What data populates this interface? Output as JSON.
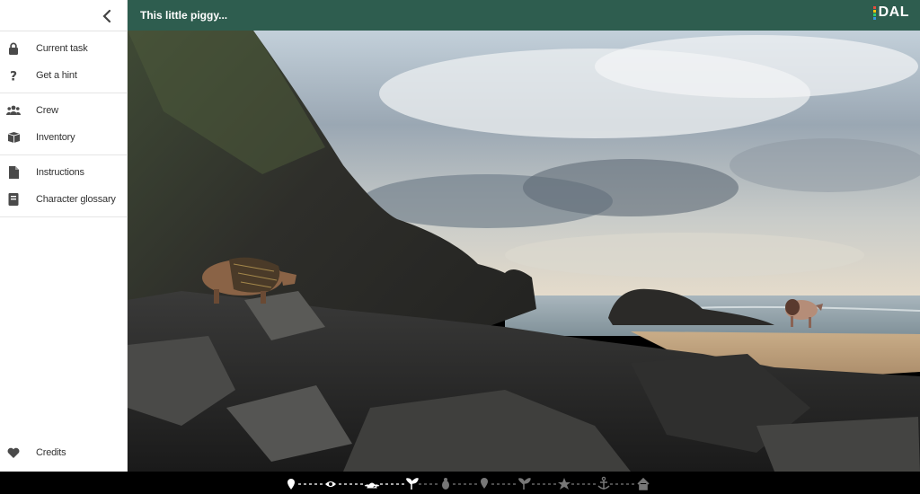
{
  "topbar": {
    "title": "This little piggy...",
    "brand": "DAL"
  },
  "sidebar": {
    "groups": [
      {
        "items": [
          {
            "label": "Current task",
            "icon": "lock-icon"
          },
          {
            "label": "Get a hint",
            "icon": "question-icon"
          }
        ]
      },
      {
        "items": [
          {
            "label": "Crew",
            "icon": "users-icon"
          },
          {
            "label": "Inventory",
            "icon": "boxes-icon"
          }
        ]
      },
      {
        "items": [
          {
            "label": "Instructions",
            "icon": "file-icon"
          },
          {
            "label": "Character glossary",
            "icon": "book-icon"
          }
        ]
      }
    ],
    "credits": {
      "label": "Credits",
      "icon": "heart-icon"
    }
  },
  "progress": {
    "steps": [
      "map-marker-icon",
      "eye-icon",
      "lotus-icon",
      "sprout-icon",
      "bug-icon",
      "map-marker-icon",
      "sprout-icon",
      "star-icon",
      "anchor-icon",
      "home-icon"
    ],
    "completed": 4
  },
  "colors": {
    "topbar": "#2e5d4f",
    "brand_bars": [
      "#e74c3c",
      "#f1c40f",
      "#2ecc71",
      "#3498db"
    ]
  }
}
